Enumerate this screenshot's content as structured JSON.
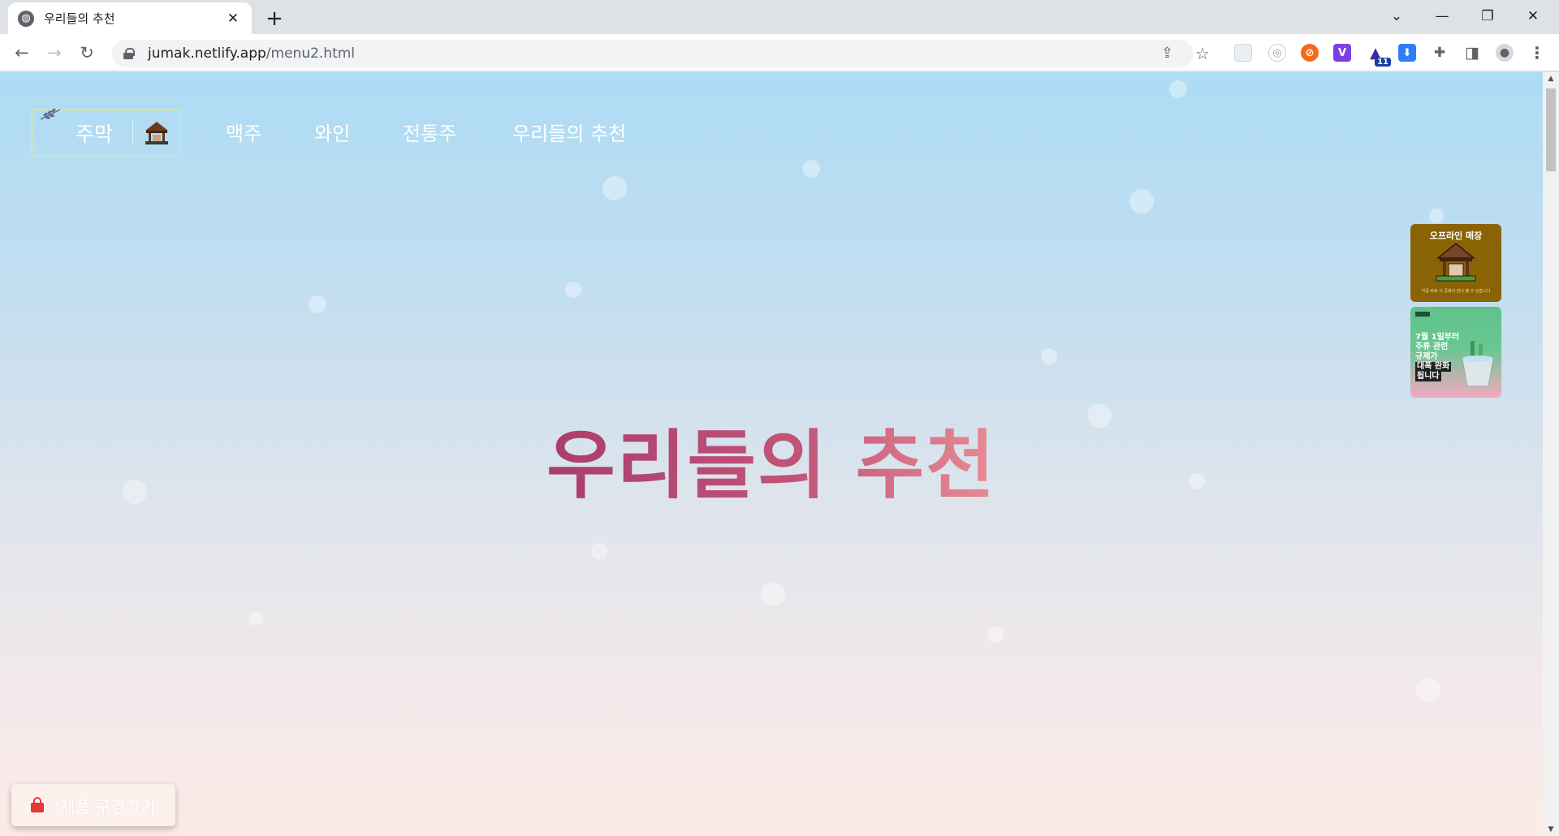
{
  "browser": {
    "tab_title": "우리들의 추천",
    "new_tab_label": "+",
    "url_host": "jumak.netlify.app",
    "url_path": "/menu2.html",
    "controls": {
      "minimize": "—",
      "restore": "❐",
      "close": "✕",
      "tab_search": "⌄"
    },
    "nav": {
      "back": "←",
      "forward": "→",
      "reload": "↻"
    },
    "omnibox_icons": {
      "share": "⇪",
      "bookmark": "☆"
    },
    "extensions": [
      {
        "name": "ext-gray",
        "glyph": "",
        "color": "#e8eaed"
      },
      {
        "name": "ext-circle",
        "glyph": "◎",
        "color": "#ffffff"
      },
      {
        "name": "ext-orange",
        "glyph": "⊘",
        "color": "#f26b1d"
      },
      {
        "name": "ext-purple-v",
        "glyph": "V",
        "color": "#7b3fe4"
      },
      {
        "name": "ext-grad-cap",
        "glyph": "🎓",
        "color": "#4527a0",
        "badge": "11"
      },
      {
        "name": "ext-download",
        "glyph": "⬇",
        "color": "#2d7ff9"
      },
      {
        "name": "ext-puzzle",
        "glyph": "✚",
        "color": "#5f6368"
      },
      {
        "name": "ext-sidepanel",
        "glyph": "◨",
        "color": "#5f6368"
      },
      {
        "name": "ext-profile",
        "glyph": "●",
        "color": "#5f6368"
      },
      {
        "name": "ext-menu",
        "glyph": "⋮",
        "color": "#5f6368"
      }
    ]
  },
  "site": {
    "logo_text": "주막",
    "nav_links": [
      "맥주",
      "와인",
      "전통주",
      "우리들의 추천"
    ],
    "hero_title": "우리들의 추천",
    "side_banners": [
      {
        "title": "오프라인 매장",
        "subtitle": "지금 바로 그 곳에서 만나 볼 수 있습니다"
      },
      {
        "lines": [
          "7월 1일부터",
          "주류 관련",
          "규제가",
          "대폭 완화",
          "됩니다"
        ]
      }
    ],
    "shop_button": "제품 구경가기"
  }
}
